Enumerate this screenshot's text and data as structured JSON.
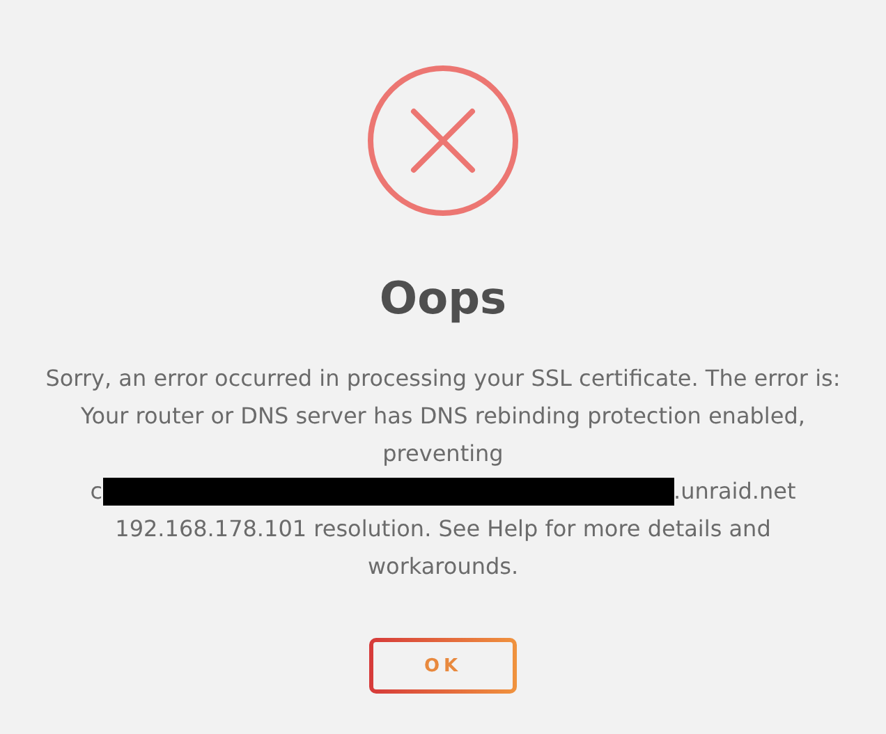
{
  "dialog": {
    "title": "Oops",
    "message_start": "Sorry, an error occurred in processing your SSL certificate. The error is: Your router or DNS server has DNS rebinding protection enabled, preventing",
    "host_prefix": "c",
    "host_suffix": ".unraid.net",
    "message_end": "192.168.178.101 resolution. See Help for more details and workarounds.",
    "button": "OK"
  }
}
